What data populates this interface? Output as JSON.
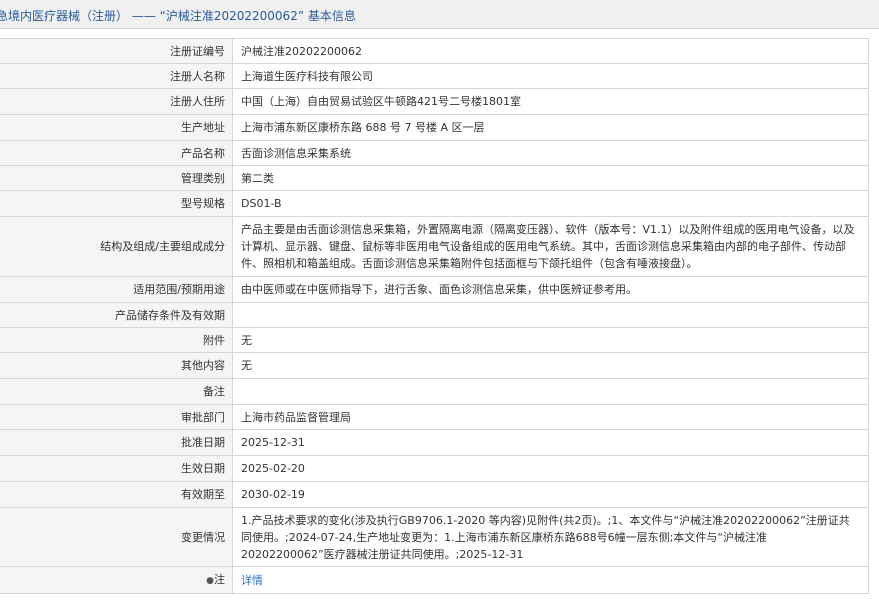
{
  "header": {
    "title": "急境内医疗器械（注册） —— “沪械注准20202200062” 基本信息"
  },
  "rows": [
    {
      "label": "注册证编号",
      "value": "沪械注准20202200062"
    },
    {
      "label": "注册人名称",
      "value": "上海道生医疗科技有限公司"
    },
    {
      "label": "注册人住所",
      "value": "中国（上海）自由贸易试验区牛顿路421号二号楼1801室"
    },
    {
      "label": "生产地址",
      "value": "上海市浦东新区康桥东路 688 号 7 号楼 A 区一层"
    },
    {
      "label": "产品名称",
      "value": "舌面诊测信息采集系统"
    },
    {
      "label": "管理类别",
      "value": "第二类"
    },
    {
      "label": "型号规格",
      "value": "DS01-B"
    },
    {
      "label": "结构及组成/主要组成成分",
      "value": "产品主要是由舌面诊测信息采集箱，外置隔离电源（隔离变压器）、软件（版本号：V1.1）以及附件组成的医用电气设备，以及计算机、显示器、键盘、鼠标等非医用电气设备组成的医用电气系统。其中，舌面诊测信息采集箱由内部的电子部件、传动部件、照相机和箱盖组成。舌面诊测信息采集箱附件包括面框与下颌托组件（包含有唾液接盘）。"
    },
    {
      "label": "适用范围/预期用途",
      "value": "由中医师或在中医师指导下，进行舌象、面色诊测信息采集，供中医辨证参考用。"
    },
    {
      "label": "产品储存条件及有效期",
      "value": ""
    },
    {
      "label": "附件",
      "value": "无"
    },
    {
      "label": "其他内容",
      "value": "无"
    },
    {
      "label": "备注",
      "value": ""
    },
    {
      "label": "审批部门",
      "value": "上海市药品监督管理局"
    },
    {
      "label": "批准日期",
      "value": "2025-12-31"
    },
    {
      "label": "生效日期",
      "value": "2025-02-20"
    },
    {
      "label": "有效期至",
      "value": "2030-02-19"
    },
    {
      "label": "变更情况",
      "value": "1.产品技术要求的变化(涉及执行GB9706.1-2020 等内容)见附件(共2页)。;1、本文件与“沪械注准20202200062”注册证共同使用。;2024-07-24,生产地址变更为：1.上海市浦东新区康桥东路688号6幢一层东侧;本文件与“沪械注准20202200062”医疗器械注册证共同使用。;2025-12-31"
    }
  ],
  "note": {
    "icon": "pin-icon",
    "label": "注",
    "link_text": "详情"
  }
}
